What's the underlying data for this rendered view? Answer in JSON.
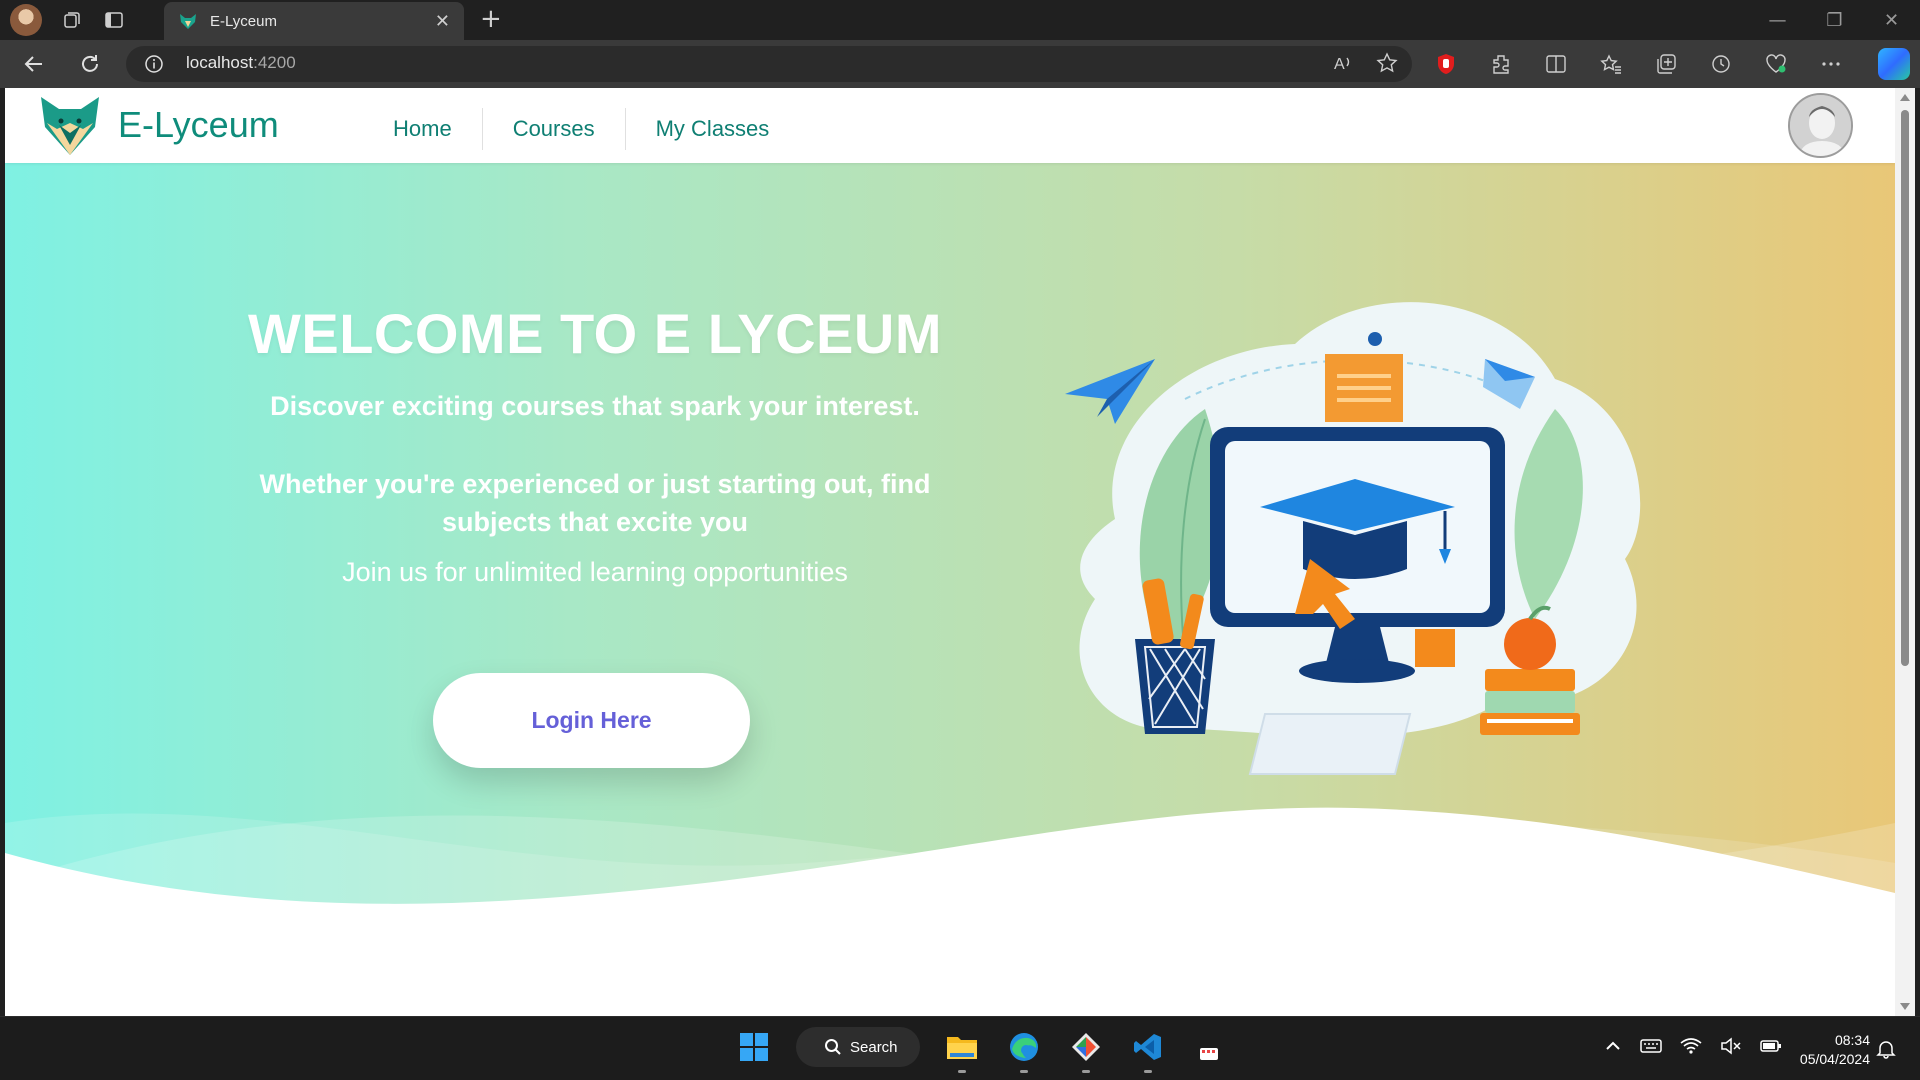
{
  "browser": {
    "tab_title": "E-Lyceum",
    "new_tab_icon": "plus-icon",
    "address_host": "localhost",
    "address_port": ":4200"
  },
  "app": {
    "brand": "E-Lyceum",
    "nav": [
      {
        "label": "Home"
      },
      {
        "label": "Courses"
      },
      {
        "label": "My Classes"
      }
    ],
    "colors": {
      "brand": "#0f8c7b",
      "button_text": "#6560d8"
    }
  },
  "hero": {
    "title": "WELCOME TO E LYCEUM",
    "subtitle": "Discover exciting courses that spark your interest.",
    "text": "Whether you're experienced or just starting out, find subjects that excite you",
    "tagline": "Join us for unlimited learning opportunities",
    "login_label": "Login Here"
  },
  "taskbar": {
    "search_label": "Search",
    "time": "08:34",
    "date": "05/04/2024"
  }
}
